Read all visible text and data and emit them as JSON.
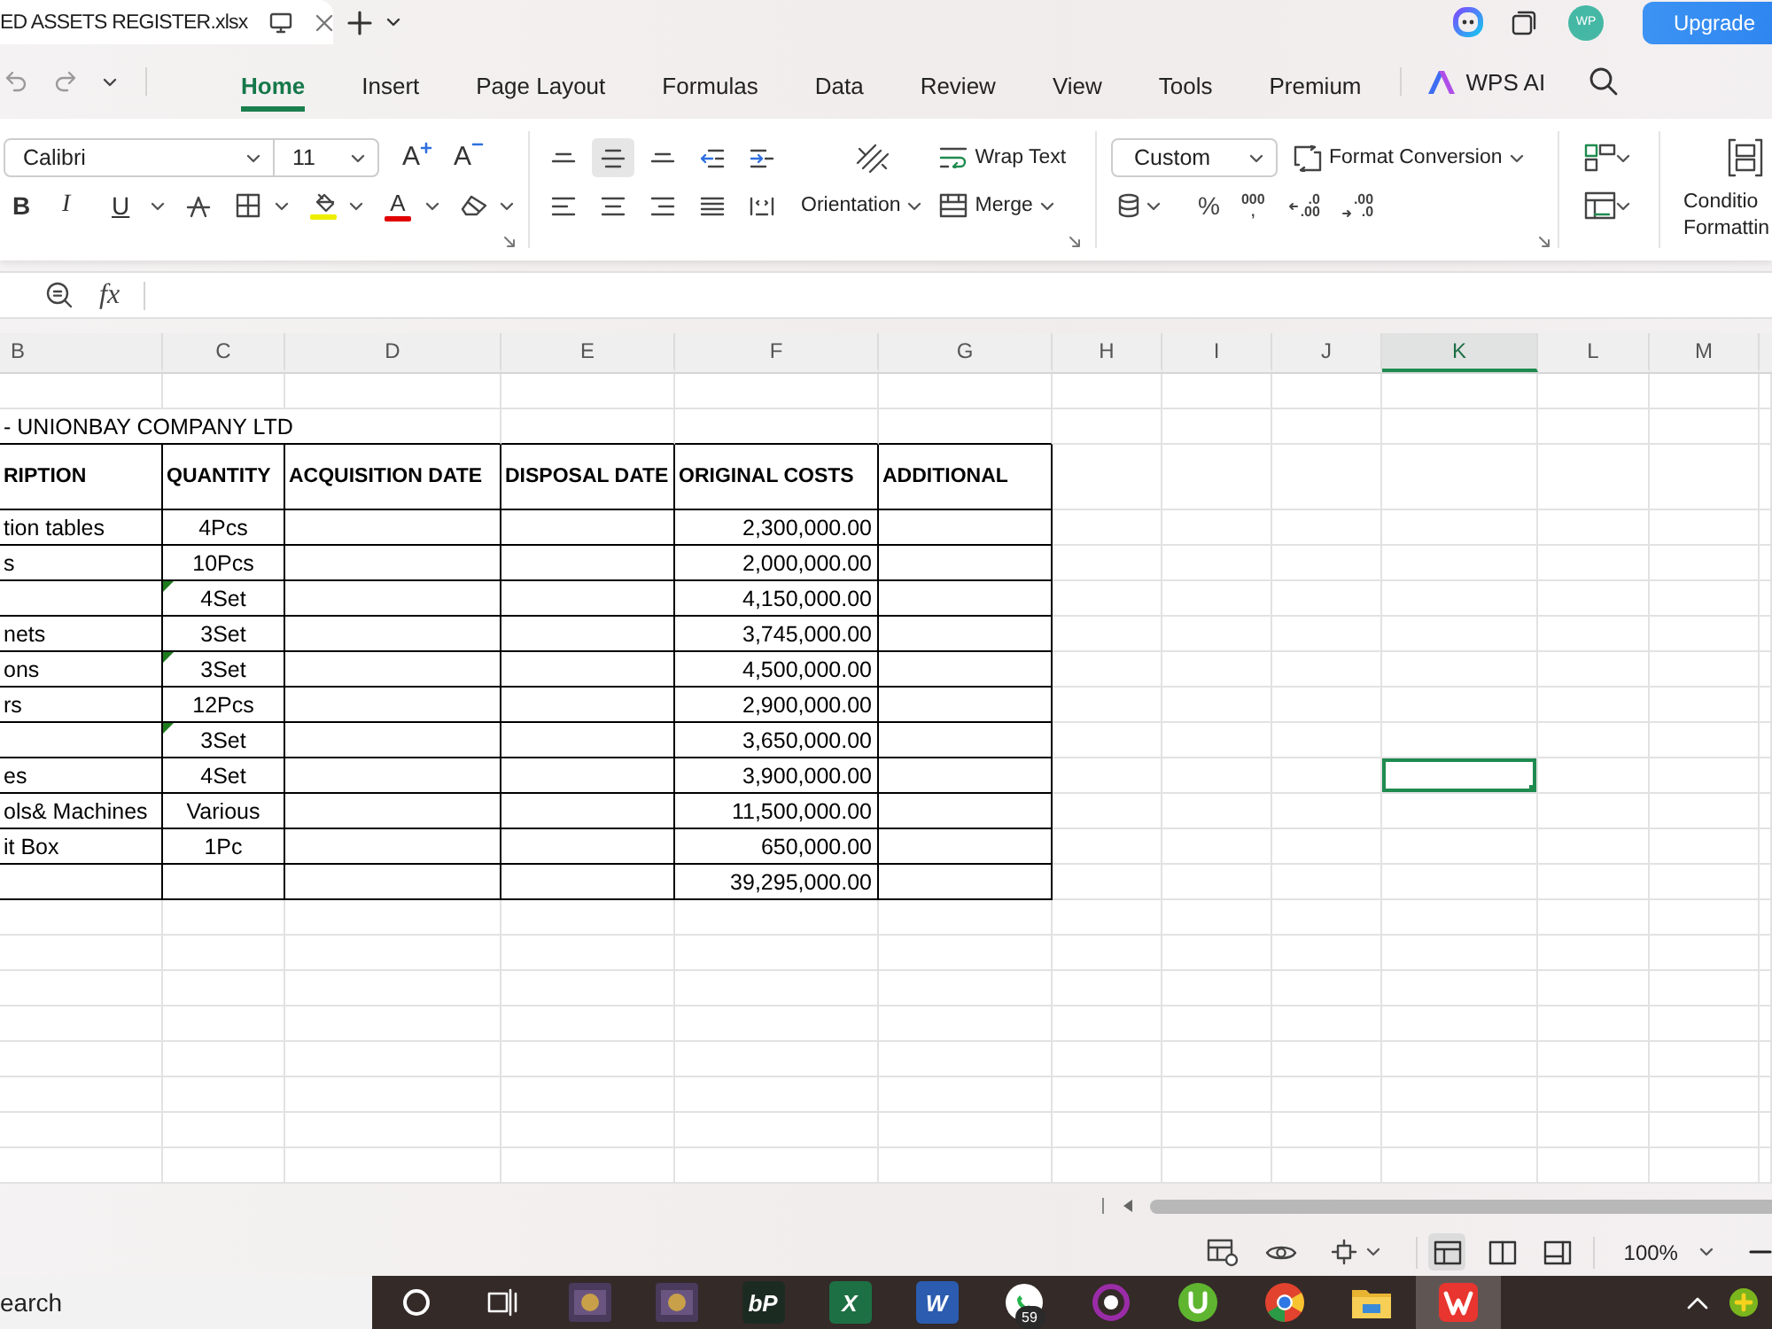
{
  "title_bar": {
    "file_tab": "ED ASSETS REGISTER.xlsx",
    "avatar": "WP",
    "upgrade": "Upgrade"
  },
  "menu": {
    "tabs": [
      {
        "label": "Home",
        "selected": true
      },
      {
        "label": "Insert",
        "selected": false
      },
      {
        "label": "Page Layout",
        "selected": false
      },
      {
        "label": "Formulas",
        "selected": false
      },
      {
        "label": "Data",
        "selected": false
      },
      {
        "label": "Review",
        "selected": false
      },
      {
        "label": "View",
        "selected": false
      },
      {
        "label": "Tools",
        "selected": false
      },
      {
        "label": "Premium",
        "selected": false
      }
    ],
    "ai_label": "WPS AI"
  },
  "ribbon": {
    "font": {
      "name": "Calibri",
      "size": "11",
      "grow": "A",
      "shrink": "A",
      "styles": [
        {
          "kind": "bold",
          "glyph": "B",
          "dropdown": false
        },
        {
          "kind": "italic",
          "glyph": "I",
          "dropdown": false
        },
        {
          "kind": "underline",
          "glyph": "U",
          "dropdown": true
        },
        {
          "kind": "strikethrough",
          "dropdown": false
        },
        {
          "kind": "borders",
          "dropdown": true
        },
        {
          "kind": "fill",
          "color": "#eeee00",
          "dropdown": true
        },
        {
          "kind": "font_color",
          "glyph": "A",
          "color": "#e00000",
          "dropdown": true
        },
        {
          "kind": "clear",
          "dropdown": true
        }
      ]
    },
    "alignment": {
      "buttons": [
        {
          "kind": "top",
          "selected": false
        },
        {
          "kind": "middle",
          "selected": true
        },
        {
          "kind": "bottom",
          "selected": false
        },
        {
          "kind": "outdent",
          "selected": false
        },
        {
          "kind": "indent",
          "selected": false
        },
        {
          "kind": "left",
          "selected": false
        },
        {
          "kind": "center",
          "selected": false
        },
        {
          "kind": "right",
          "selected": false
        },
        {
          "kind": "justify",
          "selected": false
        },
        {
          "kind": "distributed",
          "selected": false
        }
      ],
      "orientation": "Orientation",
      "wrap_text": "Wrap Text",
      "merge": "Merge"
    },
    "number": {
      "format": "Custom",
      "conversion": "Format Conversion",
      "percent": "%",
      "comma_style": [
        "000",
        ","
      ],
      "increase_decimal": [
        ".0",
        ".00"
      ],
      "decrease_decimal": [
        ".00",
        ".0"
      ]
    },
    "conditional_formatting": [
      "Conditio",
      "Formattin"
    ]
  },
  "formula_bar": {
    "function_label": "fx"
  },
  "sheet": {
    "columns": [
      {
        "label": "B",
        "selected": false
      },
      {
        "label": "C",
        "selected": false
      },
      {
        "label": "D",
        "selected": false
      },
      {
        "label": "E",
        "selected": false
      },
      {
        "label": "F",
        "selected": false
      },
      {
        "label": "G",
        "selected": false
      },
      {
        "label": "H",
        "selected": false
      },
      {
        "label": "I",
        "selected": false
      },
      {
        "label": "J",
        "selected": false
      },
      {
        "label": "K",
        "selected": true
      },
      {
        "label": "L",
        "selected": false
      },
      {
        "label": "M",
        "selected": false
      }
    ],
    "company_title": "- UNIONBAY COMPANY LTD",
    "headers": [
      "RIPTION",
      "QUANTITY",
      "ACQUISITION DATE",
      "DISPOSAL DATE",
      "ORIGINAL COSTS",
      "ADDITIONAL"
    ],
    "rows": [
      {
        "description": "tion tables",
        "quantity": "4Pcs",
        "cost": "2,300,000.00",
        "text_flag": false,
        "selected": false
      },
      {
        "description": "s",
        "quantity": "10Pcs",
        "cost": "2,000,000.00",
        "text_flag": false,
        "selected": false
      },
      {
        "quantity": "4Set",
        "cost": "4,150,000.00",
        "text_flag": true,
        "selected": false
      },
      {
        "description": "nets",
        "quantity": "3Set",
        "cost": "3,745,000.00",
        "text_flag": false,
        "selected": false
      },
      {
        "description": "ons",
        "quantity": "3Set",
        "cost": "4,500,000.00",
        "text_flag": true,
        "selected": false
      },
      {
        "description": "rs",
        "quantity": "12Pcs",
        "cost": "2,900,000.00",
        "text_flag": false,
        "selected": false
      },
      {
        "quantity": "3Set",
        "cost": "3,650,000.00",
        "text_flag": true,
        "selected": false
      },
      {
        "description": "es",
        "quantity": "4Set",
        "cost": "3,900,000.00",
        "text_flag": false,
        "selected": true
      },
      {
        "description": "ols& Machines",
        "quantity": "Various",
        "cost": "11,500,000.00",
        "text_flag": false,
        "selected": false
      },
      {
        "description": "it Box",
        "quantity": "1Pc",
        "cost": "650,000.00",
        "text_flag": false,
        "selected": false
      },
      {
        "cost": "39,295,000.00",
        "text_flag": false,
        "selected": false
      }
    ]
  },
  "status_bar": {
    "views": [
      {
        "kind": "normal",
        "selected": true
      },
      {
        "kind": "page_break",
        "selected": false
      },
      {
        "kind": "page_layout",
        "selected": false
      }
    ],
    "zoom": "100%"
  },
  "taskbar": {
    "search": {
      "placeholder": "earch"
    },
    "apps": [
      {
        "kind": "cortana",
        "active": false
      },
      {
        "kind": "task_view",
        "active": false
      },
      {
        "kind": "game",
        "active": false
      },
      {
        "kind": "game",
        "active": false
      },
      {
        "kind": "tile",
        "glyph": "bP",
        "color": "#1c2b22",
        "active": false
      },
      {
        "kind": "tile",
        "glyph": "X",
        "color": "#1d7044",
        "active": false
      },
      {
        "kind": "tile",
        "glyph": "W",
        "color": "#2b5cb0",
        "active": false
      },
      {
        "kind": "chat",
        "badge": "59",
        "active": false
      },
      {
        "kind": "ring",
        "active": false
      },
      {
        "kind": "torrent",
        "active": false
      },
      {
        "kind": "browser",
        "active": false
      },
      {
        "kind": "folder",
        "active": false
      },
      {
        "kind": "wps",
        "active": true
      }
    ]
  }
}
